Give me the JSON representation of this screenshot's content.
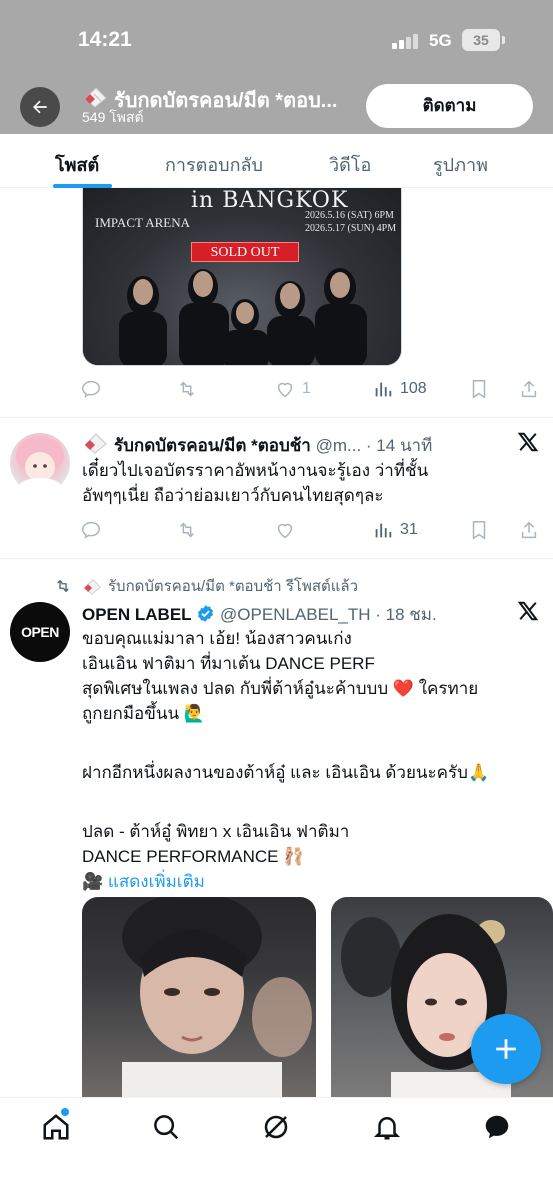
{
  "status_bar": {
    "time": "14:21",
    "network": "5G",
    "battery": "35"
  },
  "header": {
    "title": "รับกดบัตรคอน/มีต *ตอบ...",
    "subtitle": "549 โพสต์",
    "follow_label": "ติดตาม"
  },
  "tabs": [
    {
      "label": "โพสต์",
      "active": true
    },
    {
      "label": "การตอบกลับ",
      "active": false
    },
    {
      "label": "วิดีโอ",
      "active": false
    },
    {
      "label": "รูปภาพ",
      "active": false
    }
  ],
  "concert_post": {
    "poster": {
      "title": "in BANGKOK",
      "venue": "IMPACT ARENA",
      "date1": "2026.5.16 (SAT) 6PM",
      "date2": "2026.5.17 (SUN) 4PM",
      "badge": "SOLD OUT"
    },
    "likes": "1",
    "views": "108"
  },
  "post2": {
    "name": "รับกดบัตรคอน/มีต *ตอบช้า",
    "handle": "@m...",
    "time": "· 14 นาที",
    "line1": "เดี๋ยวไปเจอบัตรราคาอัพหน้างานจะรู้เอง ว่าที่ชั้น",
    "line2": "อัพๆๆเนี่ย ถือว่าย่อมเยาว์กับคนไทยสุดๆละ",
    "views": "31"
  },
  "post3": {
    "repost_label": "รับกดบัตรคอน/มีต *ตอบช้า รีโพสต์แล้ว",
    "avatar_text": "OPEN",
    "name": "OPEN LABEL",
    "handle": "@OPENLABEL_TH",
    "time": "· 18 ชม.",
    "lines": [
      "ขอบคุณแม่มาลา เอ้ย! น้องสาวคนเก่ง",
      "เอินเอิน ฟาติมา ที่มาเต้น DANCE PERF",
      "สุดพิเศษในเพลง ปลด กับพี่ต้าห์อู๋นะค้าบบบ ❤️ ใครทาย",
      "ถูกยกมือขึ้นน 🙋‍♂️",
      "",
      "ฝากอีกหนึ่งผลงานของต้าห์อู๋ และ เอินเอิน ด้วยนะครับ🙏",
      "",
      "ปลด - ต้าห์อู๋ พิทยา  x เอินเอิน ฟาติมา",
      "DANCE PERFORMANCE 🩰"
    ],
    "show_more": "แสดงเพิ่มเติม",
    "show_more_icon": "🎥"
  },
  "icons": {
    "back": "arrow-left",
    "reply": "speech-bubble",
    "repost": "two-arrows",
    "like": "heart",
    "views": "bar-chart",
    "bookmark": "bookmark",
    "share": "upload-arrow",
    "grok": "x-logo",
    "nav": [
      "home",
      "search",
      "grok",
      "bell",
      "messages"
    ]
  },
  "colors": {
    "accent": "#1d9bf0",
    "header_bg": "#a8a8a8",
    "sold_out": "#d61f26",
    "heart": "#e0245e"
  }
}
